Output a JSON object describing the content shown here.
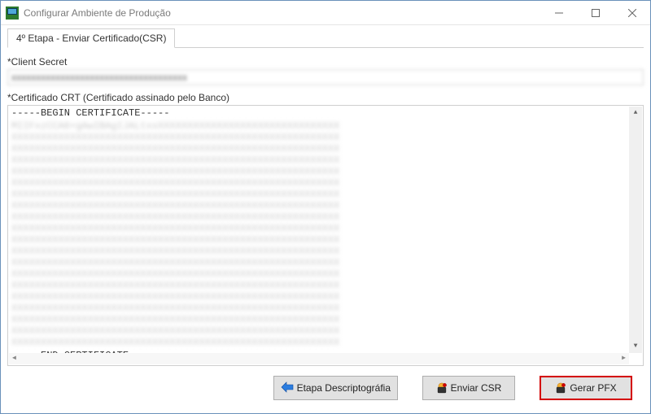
{
  "window": {
    "title": "Configurar Ambiente de Produção"
  },
  "tab": {
    "label": "4º Etapa - Enviar Certificado(CSR)"
  },
  "fields": {
    "client_secret_label": "*Client Secret",
    "client_secret_value": "xxxxxxxxxxxxxxxxxxxxxxxxxxxxxxxxxxxx",
    "cert_crt_label": "*Certificado CRT (Certificado assinado pelo Banco)",
    "cert_begin": "-----BEGIN CERTIFICATE-----",
    "cert_body": "MIIFxzCCA6+gAwIBAgIJALtxxXXXXXXXXXXXXXXXXXXXXXXXXXXXXXXXXXXXXXXXXXXXXXXXXXXXXXXXXXXXXXXXXXXXXXXXXXXXXXXXXXXXXXXXXXXXXXXXXXXXXXXXXXXXXXXXXXXXXXXXXXXXXXXXXXXXXXXXXXXXXXXXXXXXXXXXXXXXXXXXXXXXXXXXXXXXXXXXXXXXXXXXXXXXXXXXXXXXXXXXXXXXXXXXXXXXXXXXXXXXXXXXXXXXXXXXXXXXXXXXXXXXXXXXXXXXXXXXXXXXXXXXXXXXXXXXXXXXXXXXXXXXXXXXXXXXXXXXXXXXXXXXXXXXXXXXXXXXXXXXXXXXXXXXXXXXXXXXXXXXXXXXXXXXXXXXXXXXXXXXXXXXXXXXXXXXXXXXXXXXXXXXXXXXXXXXXXXXXXXXXXXXXXXXXXXXXXXXXXXXXXXXXXXXXXXXXXXXXXXXXXXXXXXXXXXXXXXXXXXXXXXXXXXXXXXXXXXXXXXXXXXXXXXXXXXXXXXXXXXXXXXXXXXXXXXXXXXXXXXXXXXXXXXXXXXXXXXXXXXXXXXXXXXXXXXXXXXXXXXXXXXXXXXXXXXXXXXXXXXXXXXXXXXXXXXXXXXXXXXXXXXXXXXXXXXXXXXXXXXXXXXXXXXXXXXXXXXXXXXXXXXXXXXXXXXXXXXXXXXXXXXXXXXXXXXXXXXXXXXXXXXXXXXXXXXXXXXXXXXXXXXXXXXXXXXXXXXXXXXXXXXXXXXXXXXXXXXXXXXXXXXXXXXXXXXXXXXXXXXXXXXXXXXXXXXXXXXXXXXXXXXXXXXXXXXXXXXXXXXXXXXXXXXXXXXXXXXXXXXXXXXXXXXXXXXXXXXXXXXXXXXXXXXXXXXXXXXXXXXXXXXXXXXXXXXXXXXXXXXXXXXXXXXXXXXXXXXXXXXXXXXXXXXXXXXXXXXXXXXXXXXXXXXXXXXXXXXXXXXXXXXXXXXXXXXXXXXXXXXXXXXXXXXXXXXXXXXXXXXXXXXXXXXXXXXXXXXXXXXXXXXXXXXXXXXXXXXXXXXXXXXXXXXXXXXXXXXXXXXXXXXXXXXXXXXXXXXXXXXXXXXXXXXXXXXXXXXXXXXXXXXXXXXXXXXXXXXX",
    "cert_end": "-----END CERTIFICATE-----"
  },
  "buttons": {
    "back": "Etapa Descriptográfia",
    "send": "Enviar CSR",
    "generate": "Gerar PFX"
  }
}
